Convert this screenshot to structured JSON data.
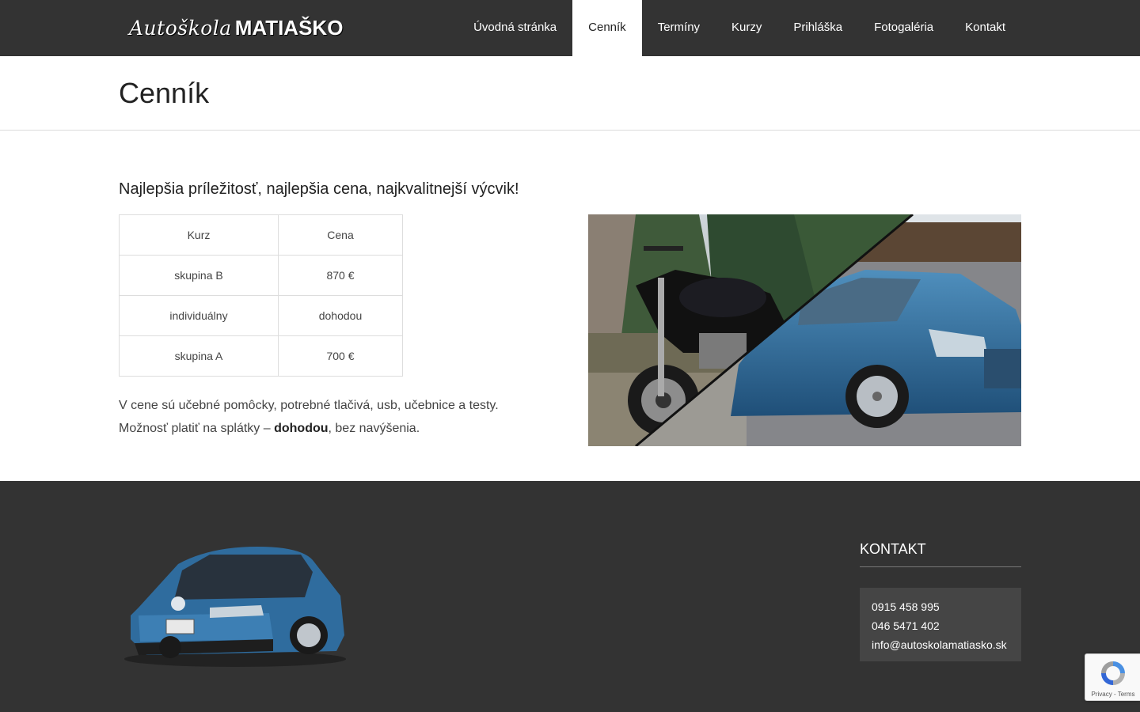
{
  "header": {
    "logo_script": "Autoškola",
    "logo_bold": "MATIAŠKO",
    "nav": [
      {
        "label": "Úvodná stránka",
        "active": false
      },
      {
        "label": "Cenník",
        "active": true
      },
      {
        "label": "Termíny",
        "active": false
      },
      {
        "label": "Kurzy",
        "active": false
      },
      {
        "label": "Prihláška",
        "active": false
      },
      {
        "label": "Fotogaléria",
        "active": false
      },
      {
        "label": "Kontakt",
        "active": false
      }
    ]
  },
  "page": {
    "title": "Cenník",
    "subheading": "Najlepšia príležitosť, najlepšia cena, najkvalitnejší výcvik!",
    "table": {
      "headers": [
        "Kurz",
        "Cena"
      ],
      "rows": [
        [
          "skupina B",
          "870 €"
        ],
        [
          "individuálny",
          "dohodou"
        ],
        [
          "skupina A",
          "700 €"
        ]
      ]
    },
    "note_line1": "V cene sú učebné pomôcky, potrebné tlačivá, usb, učebnice a testy.",
    "note_line2_before": "Možnosť platiť na splátky – ",
    "note_line2_bold": "dohodou",
    "note_line2_after": ", bez navýšenia."
  },
  "footer": {
    "contact_title": "KONTAKT",
    "phone1": "0915 458 995",
    "phone2": "046 5471 402",
    "email": "info@autoskolamatiasko.sk"
  },
  "recaptcha": {
    "links": "Privacy - Terms"
  },
  "colors": {
    "header_bg": "#333333",
    "footer_bg": "#333333",
    "contact_box_bg": "#454545",
    "car_blue": "#2f6c9e"
  }
}
